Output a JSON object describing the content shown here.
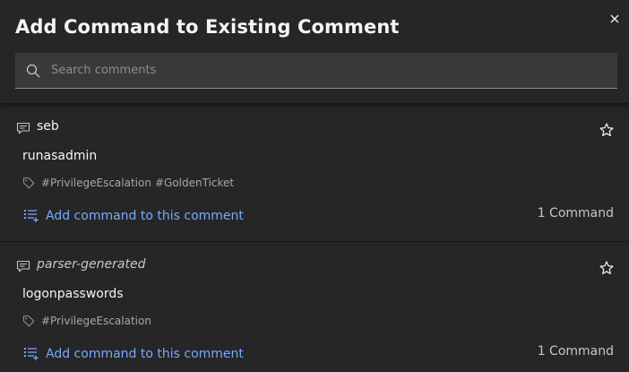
{
  "modal": {
    "title": "Add Command to Existing Comment",
    "close_icon": "close-icon"
  },
  "search": {
    "placeholder": "Search comments",
    "value": "",
    "icon": "search-icon"
  },
  "comments": [
    {
      "author": "seb",
      "text": "runasadmin",
      "tags": [
        "#PrivilegeEscalation",
        "#GoldenTicket"
      ],
      "add_label": "Add command to this comment",
      "count_label": "1 Command"
    },
    {
      "author": "parser-generated",
      "text": "logonpasswords",
      "tags": [
        "#PrivilegeEscalation"
      ],
      "add_label": "Add command to this comment",
      "count_label": "1 Command"
    }
  ],
  "colors": {
    "background": "#262626",
    "input": "#393939",
    "link": "#78a9ff",
    "text": "#f4f4f4",
    "muted": "#a8a8a8"
  }
}
